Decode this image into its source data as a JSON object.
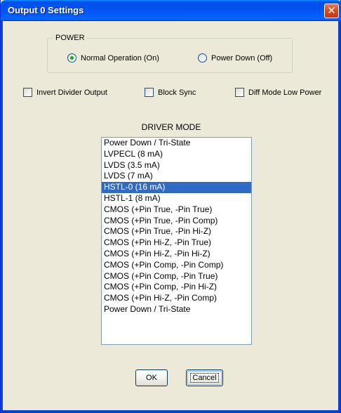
{
  "window": {
    "title": "Output 0 Settings",
    "close_symbol": "✕"
  },
  "power": {
    "group_label": "POWER",
    "normal_label": "Normal Operation (On)",
    "down_label": "Power Down (Off)",
    "selected": "normal"
  },
  "options": {
    "invert_label": "Invert Divider Output",
    "block_sync_label": "Block Sync",
    "diff_mode_label": "Diff Mode Low Power",
    "invert_checked": false,
    "block_sync_checked": false,
    "diff_mode_checked": false
  },
  "driver_mode": {
    "title": "DRIVER MODE",
    "selected_index": 4,
    "items": [
      "Power Down / Tri-State",
      "LVPECL (8 mA)",
      "LVDS (3.5 mA)",
      "LVDS (7 mA)",
      "HSTL-0 (16 mA)",
      "HSTL-1 (8 mA)",
      "CMOS (+Pin True, -Pin True)",
      "CMOS (+Pin True, -Pin Comp)",
      "CMOS (+Pin True, -Pin Hi-Z)",
      "CMOS (+Pin Hi-Z, -Pin True)",
      "CMOS (+Pin Hi-Z, -Pin Hi-Z)",
      "CMOS (+Pin Comp, -Pin Comp)",
      "CMOS (+Pin Comp, -Pin True)",
      "CMOS (+Pin Comp, -Pin Hi-Z)",
      "CMOS (+Pin Hi-Z, -Pin Comp)",
      "Power Down / Tri-State"
    ]
  },
  "buttons": {
    "ok_label": "OK",
    "cancel_label": "Cancel"
  }
}
